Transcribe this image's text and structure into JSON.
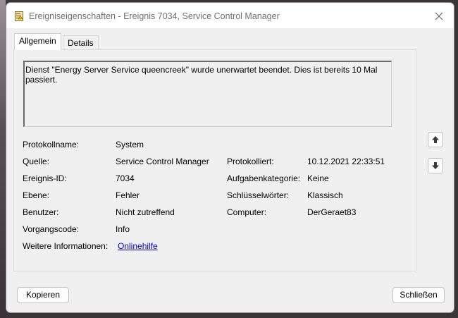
{
  "window": {
    "title": "Ereigniseigenschaften - Ereignis 7034, Service Control Manager",
    "icons": {
      "app": "event-viewer-icon",
      "close": "close-icon"
    }
  },
  "tabs": [
    {
      "label": "Allgemein",
      "active": true
    },
    {
      "label": "Details",
      "active": false
    }
  ],
  "description": "Dienst \"Energy Server Service queencreek\" wurde unerwartet beendet. Dies ist bereits 10 Mal passiert.",
  "fields": {
    "log_name": {
      "label": "Protokollname:",
      "value": "System"
    },
    "source": {
      "label": "Quelle:",
      "value": "Service Control Manager"
    },
    "logged": {
      "label": "Protokolliert:",
      "value": "10.12.2021 22:33:51"
    },
    "event_id": {
      "label": "Ereignis-ID:",
      "value": "7034"
    },
    "task_category": {
      "label": "Aufgabenkategorie:",
      "value": "Keine"
    },
    "level": {
      "label": "Ebene:",
      "value": "Fehler"
    },
    "keywords": {
      "label": "Schlüsselwörter:",
      "value": "Klassisch"
    },
    "user": {
      "label": "Benutzer:",
      "value": "Nicht zutreffend"
    },
    "computer": {
      "label": "Computer:",
      "value": "DerGeraet83"
    },
    "opcode": {
      "label": "Vorgangscode:",
      "value": "Info"
    },
    "more_info": {
      "label": "Weitere Informationen:",
      "link": "Onlinehilfe"
    }
  },
  "nav": {
    "up_icon": "arrow-up-icon",
    "down_icon": "arrow-down-icon"
  },
  "buttons": {
    "copy": "Kopieren",
    "close": "Schließen"
  },
  "colors": {
    "link": "#0000cc",
    "title_text": "#707070"
  }
}
